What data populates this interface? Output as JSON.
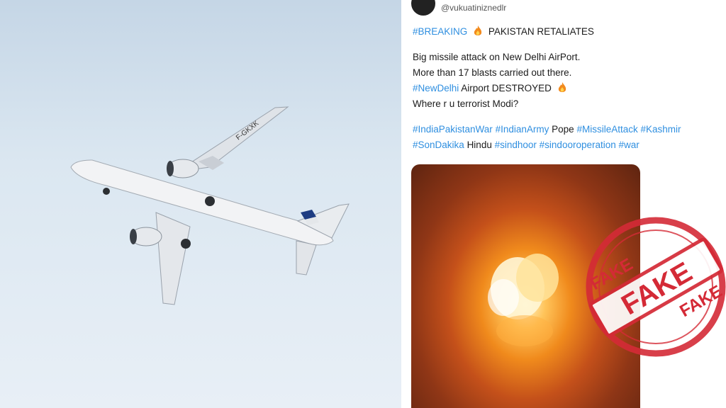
{
  "tweet": {
    "handle": "@vukuatiniznedlr",
    "tag_breaking": "#BREAKING",
    "headline": "PAKISTAN RETALIATES",
    "line1": "Big missile attack on New Delhi AirPort.",
    "line2": "More than 17 blasts carried out there.",
    "tag_newdelhi": "#NewDelhi",
    "line3_rest": "Airport DESTROYED",
    "line4": "Where r u terrorist Modi?",
    "tags_row1": [
      {
        "text": "#IndiaPakistanWar",
        "hashtag": true
      },
      {
        "text": "#IndianArmy",
        "hashtag": true
      },
      {
        "text": "Pope",
        "hashtag": false
      },
      {
        "text": "#MissileAttack",
        "hashtag": true
      },
      {
        "text": "#Kashmir",
        "hashtag": true
      }
    ],
    "tags_row2": [
      {
        "text": "#SonDakika",
        "hashtag": true
      },
      {
        "text": "Hindu",
        "hashtag": false
      },
      {
        "text": "#sindhoor",
        "hashtag": true
      },
      {
        "text": "#sindooroperation",
        "hashtag": true
      },
      {
        "text": "#war",
        "hashtag": true
      }
    ]
  },
  "airplane": {
    "registration": "F-GKXK"
  },
  "stamp": {
    "text": "FAKE",
    "color": "#d42a36"
  },
  "colors": {
    "hashtag": "#2f8fe0",
    "sky": "#dbe7f1"
  }
}
